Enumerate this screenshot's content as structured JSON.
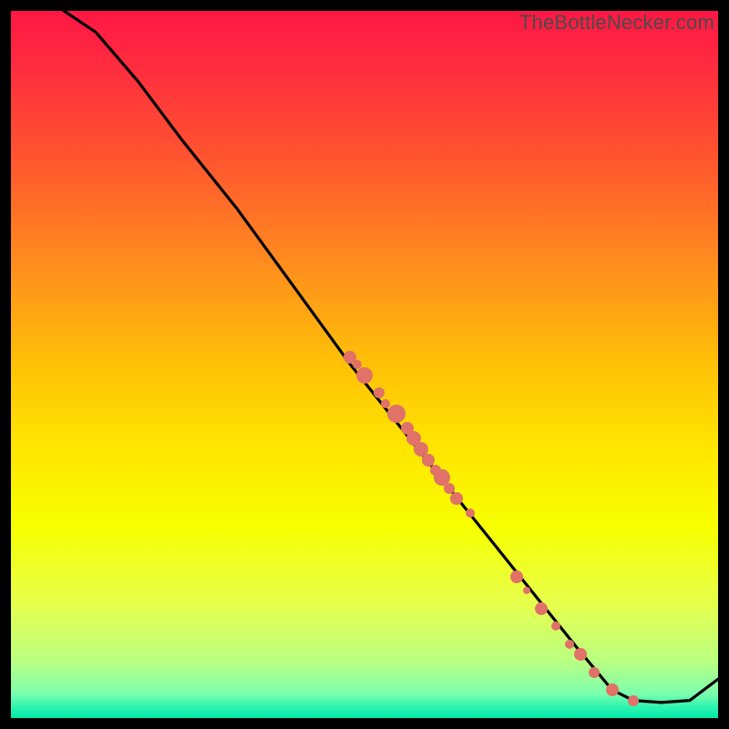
{
  "watermark_text": "TheBottleNecker.com",
  "colors": {
    "background": "#000000",
    "dot": "#e07268",
    "line": "#000000",
    "gradient_stops": [
      {
        "offset": 0.0,
        "color": "#ff1744"
      },
      {
        "offset": 0.08,
        "color": "#ff2d3f"
      },
      {
        "offset": 0.2,
        "color": "#ff5230"
      },
      {
        "offset": 0.35,
        "color": "#ff8a1f"
      },
      {
        "offset": 0.5,
        "color": "#ffc107"
      },
      {
        "offset": 0.62,
        "color": "#ffe600"
      },
      {
        "offset": 0.73,
        "color": "#f7ff00"
      },
      {
        "offset": 0.84,
        "color": "#e6ff4d"
      },
      {
        "offset": 0.92,
        "color": "#b9ff82"
      },
      {
        "offset": 0.965,
        "color": "#7dffad"
      },
      {
        "offset": 0.985,
        "color": "#2cf4b0"
      },
      {
        "offset": 1.0,
        "color": "#00e8a8"
      }
    ]
  },
  "chart_data": {
    "type": "line",
    "title": "",
    "xlabel": "",
    "ylabel": "",
    "xlim": [
      0,
      100
    ],
    "ylim": [
      0,
      100
    ],
    "series": [
      {
        "name": "curve",
        "points": [
          {
            "x": 0,
            "y": 102
          },
          {
            "x": 6,
            "y": 101
          },
          {
            "x": 12,
            "y": 97
          },
          {
            "x": 18,
            "y": 90
          },
          {
            "x": 24,
            "y": 82
          },
          {
            "x": 32,
            "y": 72
          },
          {
            "x": 40,
            "y": 61
          },
          {
            "x": 48,
            "y": 50
          },
          {
            "x": 56,
            "y": 40
          },
          {
            "x": 64,
            "y": 30
          },
          {
            "x": 72,
            "y": 20
          },
          {
            "x": 80,
            "y": 10
          },
          {
            "x": 85,
            "y": 4
          },
          {
            "x": 88,
            "y": 2.5
          },
          {
            "x": 92,
            "y": 2.2
          },
          {
            "x": 96,
            "y": 2.5
          },
          {
            "x": 100,
            "y": 5.5
          }
        ]
      }
    ],
    "scatter": [
      {
        "x": 48,
        "y": 51,
        "r": 7
      },
      {
        "x": 49,
        "y": 50,
        "r": 5
      },
      {
        "x": 50,
        "y": 48.5,
        "r": 9
      },
      {
        "x": 52,
        "y": 46,
        "r": 6
      },
      {
        "x": 53,
        "y": 44.5,
        "r": 5
      },
      {
        "x": 54.5,
        "y": 43,
        "r": 10
      },
      {
        "x": 56,
        "y": 41,
        "r": 7
      },
      {
        "x": 57,
        "y": 39.5,
        "r": 8
      },
      {
        "x": 58,
        "y": 38,
        "r": 8
      },
      {
        "x": 59,
        "y": 36.5,
        "r": 7
      },
      {
        "x": 60,
        "y": 35,
        "r": 6
      },
      {
        "x": 61,
        "y": 34,
        "r": 9
      },
      {
        "x": 62,
        "y": 32.5,
        "r": 6
      },
      {
        "x": 63,
        "y": 31,
        "r": 7
      },
      {
        "x": 65,
        "y": 29,
        "r": 5
      },
      {
        "x": 71.5,
        "y": 20,
        "r": 7
      },
      {
        "x": 73,
        "y": 18,
        "r": 4
      },
      {
        "x": 75,
        "y": 15.5,
        "r": 7
      },
      {
        "x": 77,
        "y": 13,
        "r": 5
      },
      {
        "x": 79,
        "y": 10.5,
        "r": 5
      },
      {
        "x": 80.5,
        "y": 9,
        "r": 7
      },
      {
        "x": 82.5,
        "y": 6.5,
        "r": 6
      },
      {
        "x": 85,
        "y": 4,
        "r": 7
      },
      {
        "x": 88,
        "y": 2.5,
        "r": 6
      }
    ]
  }
}
